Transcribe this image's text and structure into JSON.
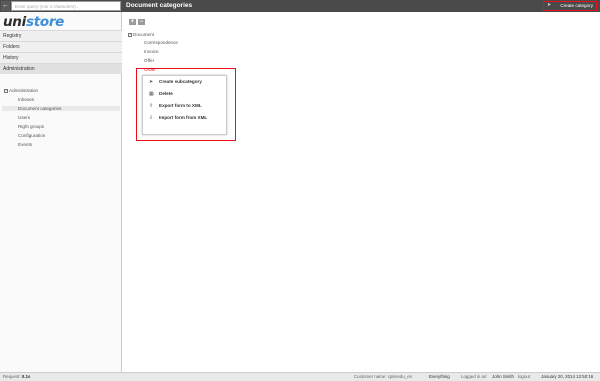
{
  "topbar": {
    "search_placeholder": "Enter query (min 3 characters)..",
    "back_icon": "arrow-left-icon",
    "page_title": "Document categories",
    "create_category_label": "Create category"
  },
  "sidebar": {
    "logo_part1": "uni",
    "logo_part2": "store",
    "nav": [
      "Registry",
      "Folders",
      "History",
      "Administration"
    ],
    "tree_root": "Administration",
    "tree_items": [
      "Inboxes",
      "Document categories",
      "Users",
      "Right groups",
      "Configuration",
      "Events"
    ],
    "selected_index": 1
  },
  "main": {
    "tree_root": "Document",
    "items": [
      "Correspondence",
      "Invoice",
      "Offer",
      "Order"
    ],
    "context_menu": [
      {
        "label": "Create subcategory",
        "icon": "rocket-icon"
      },
      {
        "label": "Delete",
        "icon": "trash-icon"
      },
      {
        "label": "Export form to XML",
        "icon": "export-icon"
      },
      {
        "label": "Import form from XML",
        "icon": "import-icon"
      }
    ]
  },
  "status": {
    "request_label": "Request: ",
    "request_value": "0.1s",
    "customer_label": "Customer name: ",
    "customer_value": "cpteredu_en",
    "scope": "Everything",
    "logged_label": "Logged in as:",
    "user_name": "John Smith",
    "logout": "logout",
    "datetime": "January 20, 2014 12:50:16"
  },
  "colors": {
    "accent_red": "#e8101a",
    "logo_blue": "#3d8ed6",
    "topbar_bg": "#4a4a4a"
  }
}
